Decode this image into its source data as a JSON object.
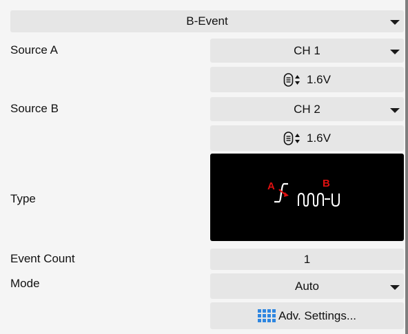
{
  "header": {
    "title": "B-Event",
    "icon": "chevron-down-icon"
  },
  "rows": {
    "source_a": {
      "label": "Source A",
      "value": "CH 1",
      "level": "1.6V"
    },
    "source_b": {
      "label": "Source B",
      "value": "CH 2",
      "level": "1.6V"
    },
    "type": {
      "label": "Type",
      "marker_a": "A",
      "marker_b": "B"
    },
    "event_count": {
      "label": "Event Count",
      "value": "1"
    },
    "mode": {
      "label": "Mode",
      "value": "Auto"
    }
  },
  "adv_settings": {
    "label": "Adv. Settings...",
    "icon": "grid-icon"
  },
  "colors": {
    "field_bg": "#e6e6e6",
    "type_bg": "#000000",
    "marker": "#e01010",
    "icon_blue": "#2e86e0"
  }
}
